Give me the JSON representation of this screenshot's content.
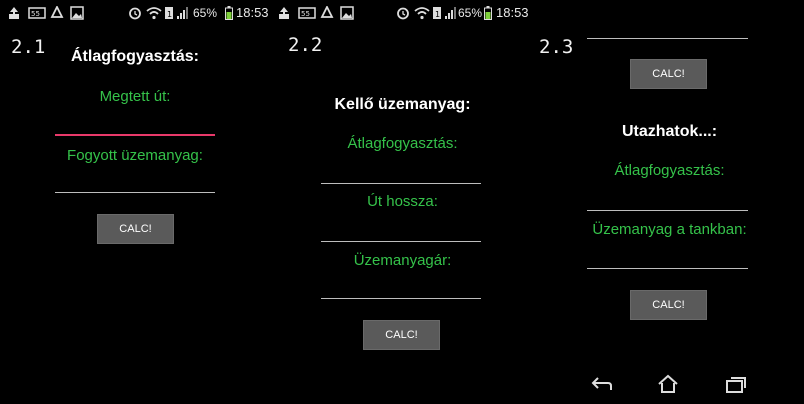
{
  "status": {
    "battery": "65%",
    "time": "18:53"
  },
  "screens": [
    {
      "step": "2.1",
      "title": "Átlagfogyasztás:",
      "fields": [
        {
          "label": "Megtett út:",
          "value": "",
          "focused": true
        },
        {
          "label": "Fogyott üzemanyag:",
          "value": ""
        }
      ],
      "button": "CALC!"
    },
    {
      "step": "2.2",
      "title": "Kellő üzemanyag:",
      "fields": [
        {
          "label": "Átlagfogyasztás:",
          "value": ""
        },
        {
          "label": "Út hossza:",
          "value": ""
        },
        {
          "label": "Üzemanyagár:",
          "value": ""
        }
      ],
      "button": "CALC!"
    },
    {
      "step": "2.3",
      "top_button": "CALC!",
      "title": "Utazhatok...:",
      "fields": [
        {
          "label": "Átlagfogyasztás:",
          "value": ""
        },
        {
          "label": "Üzemanyag a tankban:",
          "value": ""
        }
      ],
      "button": "CALC!"
    }
  ],
  "colors": {
    "label_green": "#35c24a",
    "focus_underline": "#e8396a",
    "button_bg": "#5a5a5a"
  },
  "icons": [
    "upload-icon",
    "notification-icon",
    "recycle-icon",
    "image-icon",
    "alarm-icon",
    "wifi-icon",
    "signal-icon",
    "battery-icon",
    "back-icon",
    "home-icon",
    "recent-apps-icon"
  ]
}
